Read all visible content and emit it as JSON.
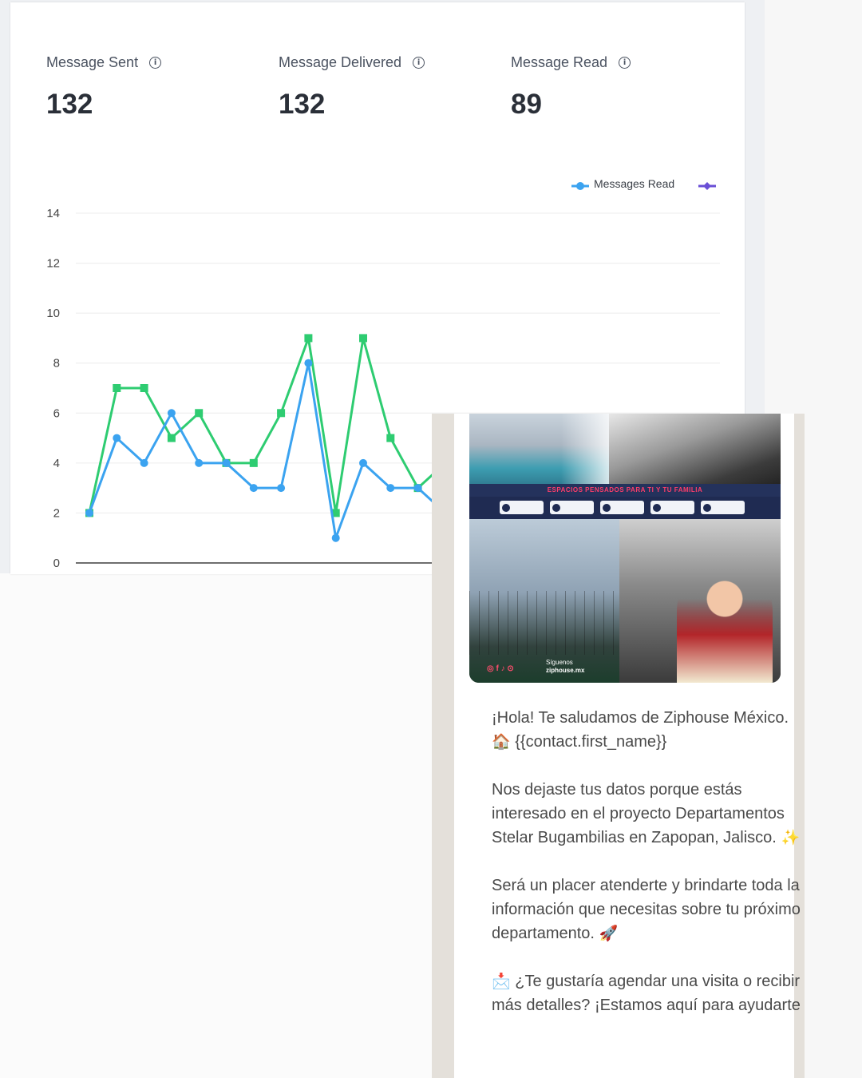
{
  "stats": [
    {
      "label": "Message Sent",
      "value": "132",
      "icon": "info-icon"
    },
    {
      "label": "Message Delivered",
      "value": "132",
      "icon": "info-icon"
    },
    {
      "label": "Message Read",
      "value": "89",
      "icon": "info-icon"
    }
  ],
  "chart_data": {
    "type": "line",
    "ylim": [
      0,
      14
    ],
    "yticks": [
      "0",
      "2",
      "4",
      "6",
      "8",
      "10",
      "12",
      "14"
    ],
    "grid": true,
    "legend": "top-right",
    "legend_entries": [
      "Messages Read",
      ""
    ],
    "series": [
      {
        "color": "#2ecc71",
        "marker": "square",
        "values": [
          2,
          7,
          7,
          5,
          6,
          4,
          4,
          6,
          9,
          2,
          9,
          5,
          3,
          4
        ]
      },
      {
        "name": "Messages Read",
        "color": "#3ba3f0",
        "marker": "circle",
        "values": [
          2,
          5,
          4,
          6,
          4,
          4,
          3,
          3,
          8,
          1,
          4,
          3,
          3,
          2
        ]
      },
      {
        "color": "#6a4fd6",
        "marker": "diamond",
        "values": []
      }
    ]
  },
  "message": {
    "promo_band": "ESPACIOS PENSADOS PARA TI Y TU FAMILIA",
    "promo_follow": "Síguenos",
    "promo_handle": "ziphouse.mx",
    "p1_text": "¡Hola! Te saludamos de Ziphouse México.",
    "p1_emoji": "🏠",
    "p1_var": "{{contact.first_name}}",
    "p2_text": "Nos dejaste tus datos porque estás interesado en el proyecto Departamentos Stelar Bugambilias en Zapopan, Jalisco.",
    "p2_emoji": "✨",
    "p3_text": "Será un placer atenderte y brindarte toda la información que necesitas sobre tu próximo departamento.",
    "p3_emoji": "🚀",
    "p4_emoji": "📩",
    "p4_text": "¿Te gustaría agendar una visita o recibir más detalles? ¡Estamos aquí para ayudarte"
  },
  "colors": {
    "green": "#2ecc71",
    "blue": "#3ba3f0",
    "purple": "#6a4fd6"
  }
}
